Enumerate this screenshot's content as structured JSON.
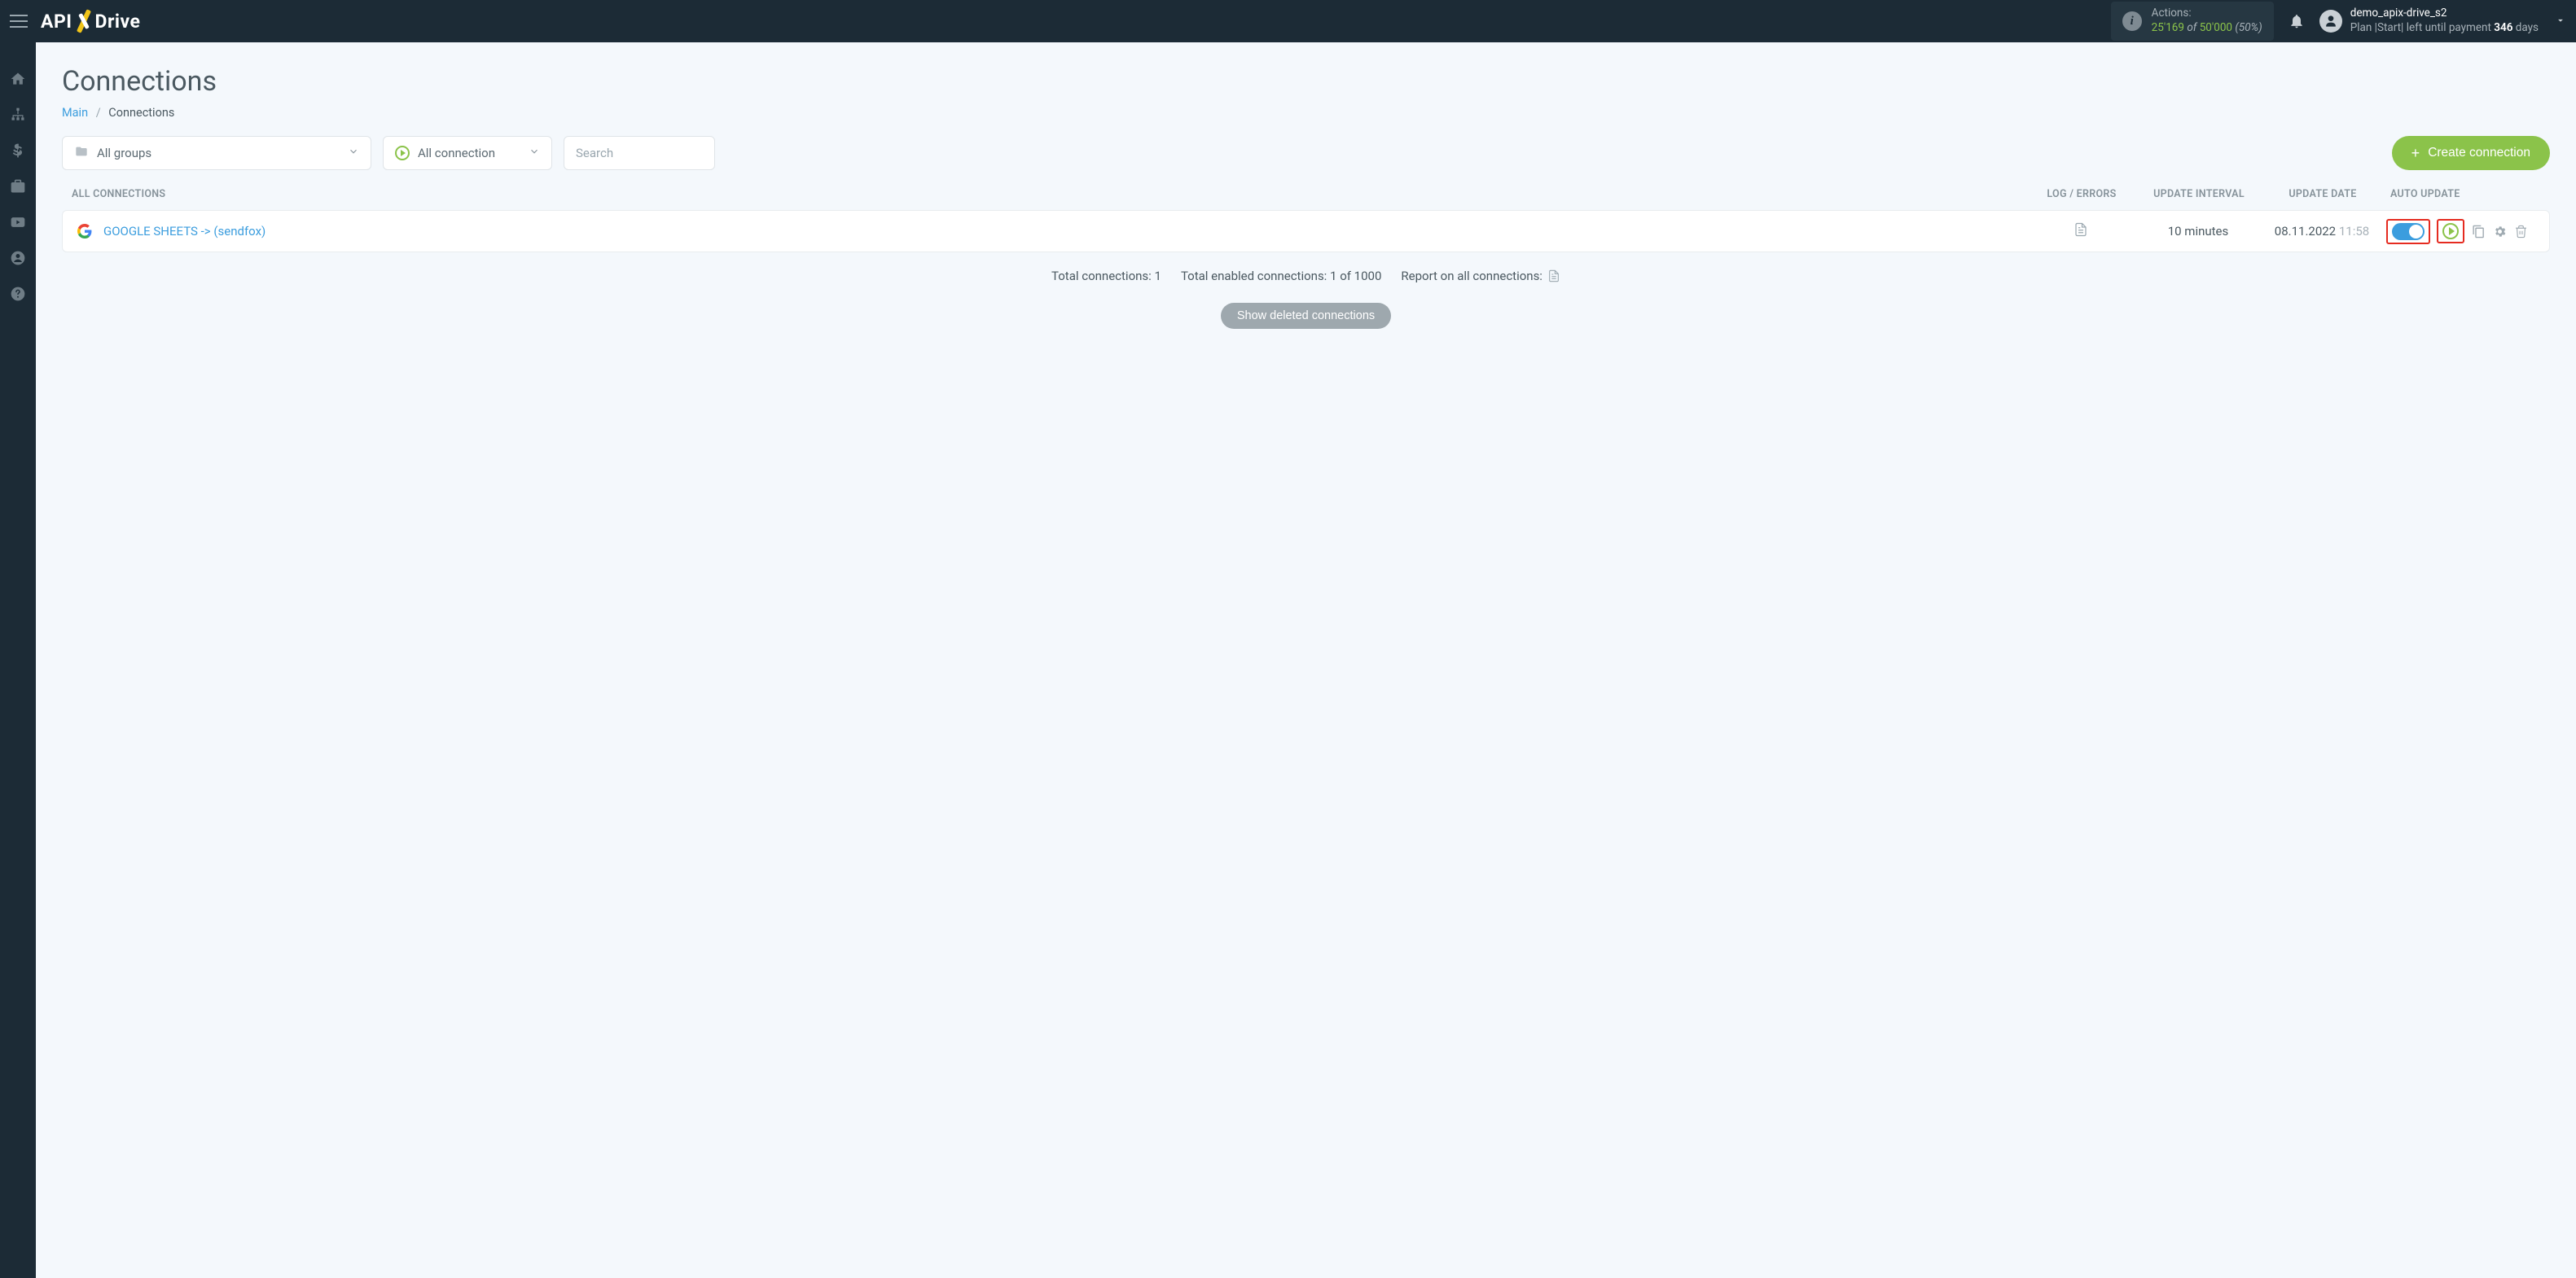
{
  "logo": {
    "pre": "API",
    "post": "Drive"
  },
  "header": {
    "actions_label": "Actions:",
    "actions_used": "25'169",
    "actions_of": "of",
    "actions_total": "50'000",
    "actions_pct": "(50%)",
    "username": "demo_apix-drive_s2",
    "plan_prefix": "Plan |Start| left until payment",
    "plan_days": "346",
    "plan_suffix": "days"
  },
  "page": {
    "title": "Connections",
    "bc_main": "Main",
    "bc_current": "Connections"
  },
  "controls": {
    "groups_label": "All groups",
    "conn_label": "All connection",
    "search_placeholder": "Search",
    "create_label": "Create connection"
  },
  "table": {
    "h_all": "ALL CONNECTIONS",
    "h_log": "LOG / ERRORS",
    "h_interval": "UPDATE INTERVAL",
    "h_date": "UPDATE DATE",
    "h_auto": "AUTO UPDATE",
    "rows": [
      {
        "name": "GOOGLE SHEETS -> (sendfox)",
        "interval": "10 minutes",
        "date": "08.11.2022",
        "time": "11:58",
        "enabled": true
      }
    ]
  },
  "summary": {
    "total": "Total connections: 1",
    "enabled": "Total enabled connections: 1 of 1000",
    "report": "Report on all connections:"
  },
  "deleted_btn": "Show deleted connections"
}
